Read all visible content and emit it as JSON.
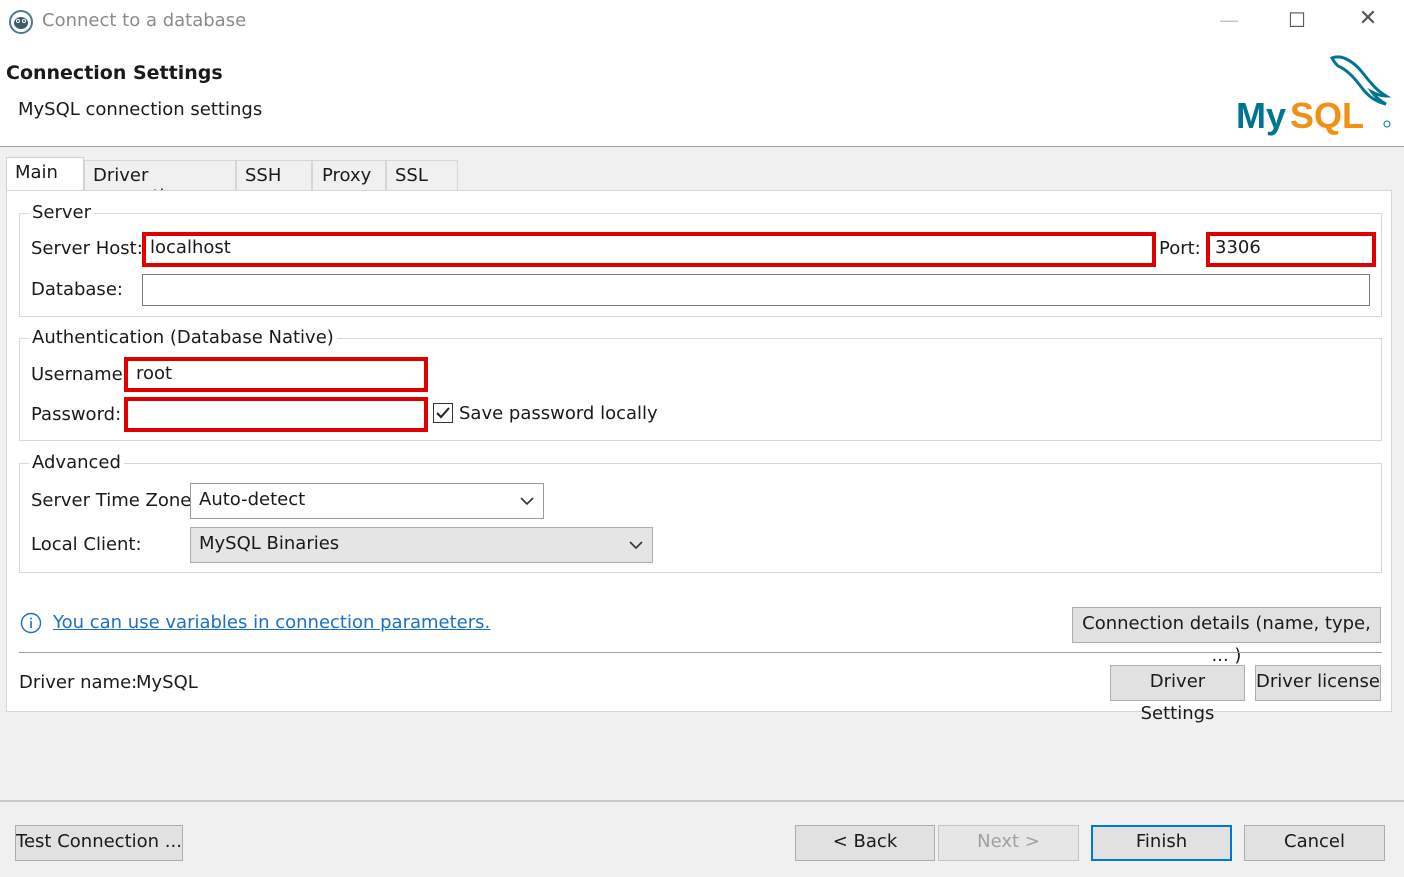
{
  "window": {
    "title": "Connect to a database",
    "minimize": "—",
    "maximize": "☐",
    "close": "✕"
  },
  "header": {
    "title": "Connection Settings",
    "subtitle": "MySQL connection settings",
    "logo_text": "MySQL",
    "logo_color": "#00758f",
    "logo_accent": "#f29111"
  },
  "tabs": [
    {
      "label": "Main",
      "active": true
    },
    {
      "label": "Driver properties",
      "active": false
    },
    {
      "label": "SSH",
      "active": false
    },
    {
      "label": "Proxy",
      "active": false
    },
    {
      "label": "SSL",
      "active": false
    }
  ],
  "server": {
    "group_label": "Server",
    "host_label": "Server Host:",
    "host_value": "localhost",
    "port_label": "Port:",
    "port_value": "3306",
    "database_label": "Database:",
    "database_value": ""
  },
  "auth": {
    "group_label": "Authentication (Database Native)",
    "username_label": "Username:",
    "username_value": "root",
    "password_label": "Password:",
    "password_value": "",
    "save_password_label": "Save password locally",
    "save_password_checked": true
  },
  "advanced": {
    "group_label": "Advanced",
    "timezone_label": "Server Time Zone:",
    "timezone_value": "Auto-detect",
    "local_client_label": "Local Client:",
    "local_client_value": "MySQL Binaries"
  },
  "info_link": "You can use variables in connection parameters.",
  "connection_details_button": "Connection details (name, type, ... )",
  "driver": {
    "name_label": "Driver name:",
    "name_value": "MySQL",
    "settings_button": "Driver Settings",
    "license_button": "Driver license"
  },
  "footer": {
    "test_button": "Test Connection ...",
    "back_button": "< Back",
    "next_button": "Next >",
    "finish_button": "Finish",
    "cancel_button": "Cancel"
  },
  "colors": {
    "highlight": "#e00000",
    "link": "#1a6fc8",
    "primary_border": "#0078d7"
  }
}
